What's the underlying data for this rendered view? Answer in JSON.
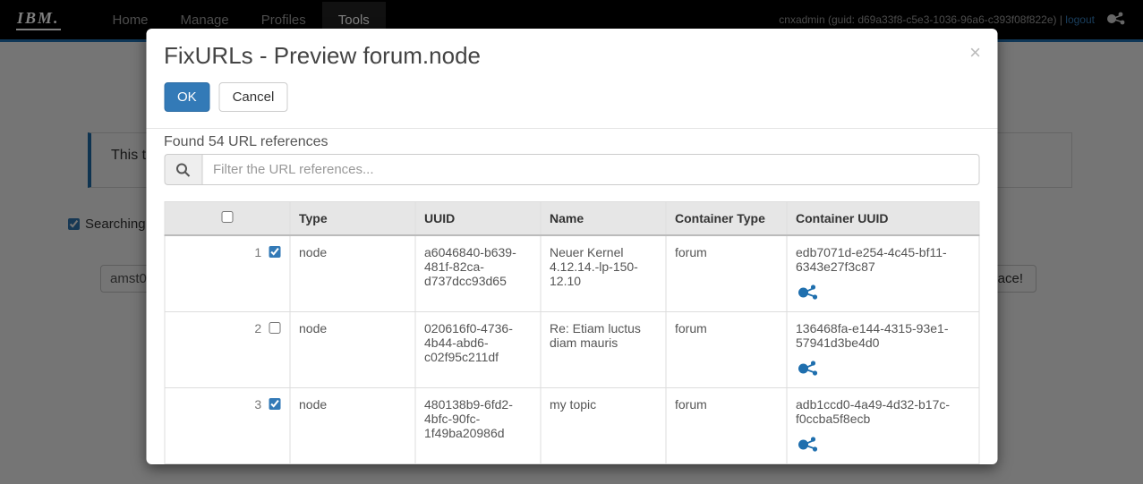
{
  "nav": {
    "logo": "IBM.",
    "links": [
      "Home",
      "Manage",
      "Profiles",
      "Tools"
    ],
    "active_index": 3,
    "user_text": "cnxadmin (guid: d69a33f8-c5e3-1036-96a6-c393f08f822e) | ",
    "logout": "logout"
  },
  "background": {
    "panel_text": "This ta",
    "searching_label": "Searching",
    "amst_text": "amst0",
    "replace_text": "place!"
  },
  "modal": {
    "title": "FixURLs - Preview forum.node",
    "ok": "OK",
    "cancel": "Cancel",
    "found_text": "Found 54 URL references",
    "filter_placeholder": "Filter the URL references...",
    "columns": {
      "type": "Type",
      "uuid": "UUID",
      "name": "Name",
      "container_type": "Container Type",
      "container_uuid": "Container UUID"
    },
    "rows": [
      {
        "index": "1",
        "checked": true,
        "type": "node",
        "uuid": "a6046840-b639-481f-82ca-d737dcc93d65",
        "name": "Neuer Kernel 4.12.14.-lp-150-12.10",
        "container_type": "forum",
        "container_uuid": "edb7071d-e254-4c45-bf11-6343e27f3c87"
      },
      {
        "index": "2",
        "checked": false,
        "type": "node",
        "uuid": "020616f0-4736-4b44-abd6-c02f95c211df",
        "name": "Re: Etiam luctus diam mauris",
        "container_type": "forum",
        "container_uuid": "136468fa-e144-4315-93e1-57941d3be4d0"
      },
      {
        "index": "3",
        "checked": true,
        "type": "node",
        "uuid": "480138b9-6fd2-4bfc-90fc-1f49ba20986d",
        "name": "my topic",
        "container_type": "forum",
        "container_uuid": "adb1ccd0-4a49-4d32-b17c-f0ccba5f8ecb"
      }
    ]
  }
}
